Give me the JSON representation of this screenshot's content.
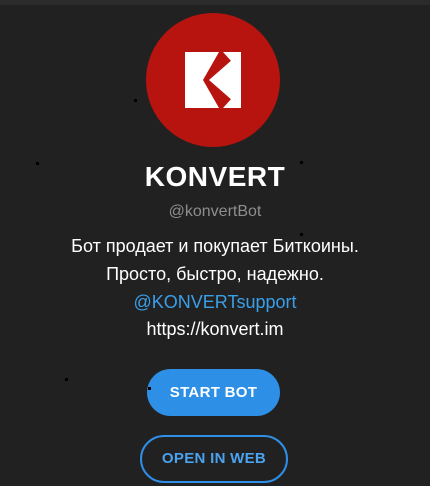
{
  "profile": {
    "name": "KONVERT",
    "username": "@konvertBot",
    "description_lines": [
      "Бот продает и покупает Биткоины.",
      "Просто, быстро, надежно."
    ],
    "support_link": "@KONVERTsupport",
    "website": "https://konvert.im",
    "avatar_icon": "konvert-k-logo-icon"
  },
  "actions": {
    "start_label": "START BOT",
    "open_web_label": "OPEN IN WEB"
  },
  "colors": {
    "background": "#212121",
    "avatar_red": "#b8140f",
    "accent_blue": "#2e8fe6",
    "link_blue": "#3a9fe9",
    "muted_text": "#8e8e8e"
  }
}
